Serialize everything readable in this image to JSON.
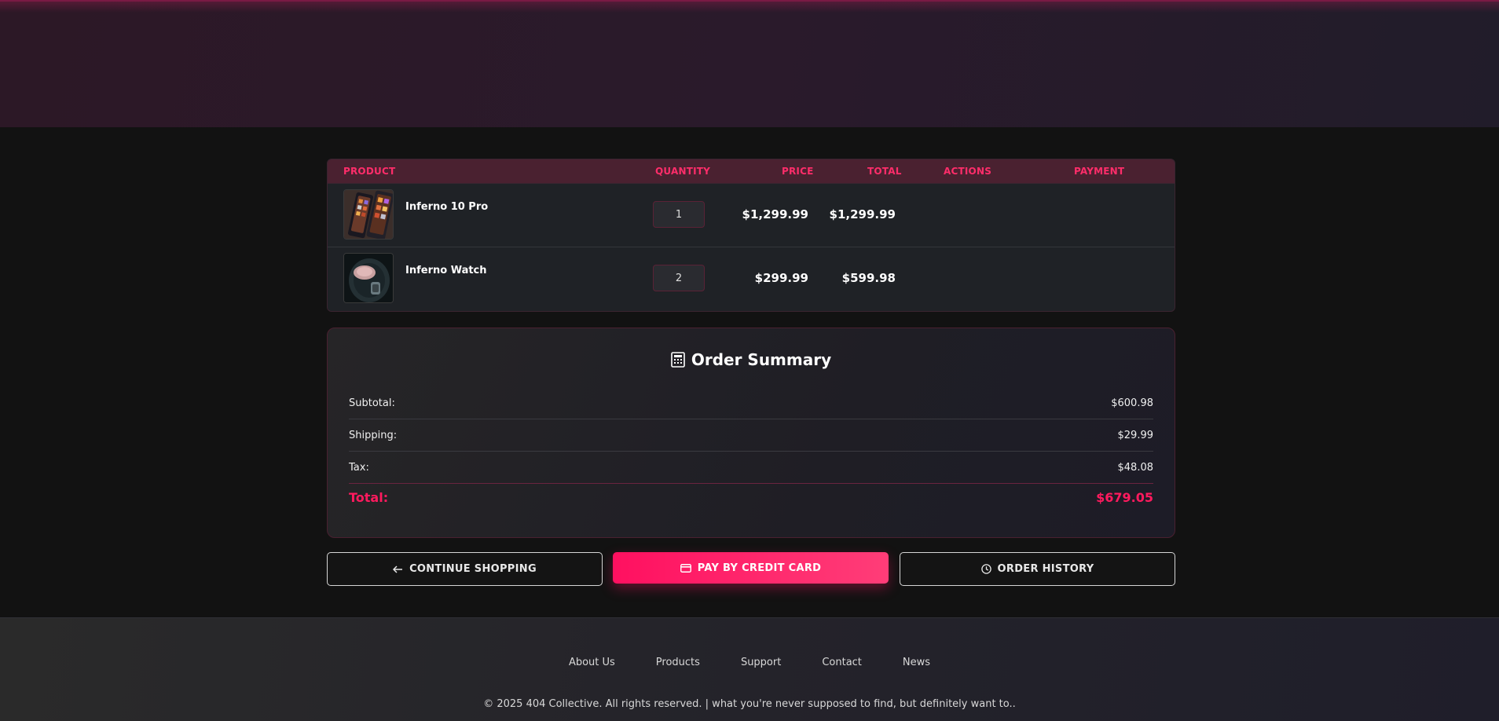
{
  "table": {
    "headers": {
      "product": "PRODUCT",
      "quantity": "QUANTITY",
      "price": "PRICE",
      "total": "TOTAL",
      "actions": "ACTIONS",
      "payment": "PAYMENT"
    },
    "rows": [
      {
        "name": "Inferno 10 Pro",
        "quantity": "1",
        "price": "$1,299.99",
        "total": "$1,299.99",
        "image": "phone-image"
      },
      {
        "name": "Inferno Watch",
        "quantity": "2",
        "price": "$299.99",
        "total": "$599.98",
        "image": "watch-image"
      }
    ]
  },
  "summary": {
    "icon": "receipt-icon",
    "title": "Order Summary",
    "subtotal_label": "Subtotal:",
    "subtotal_value": "$600.98",
    "shipping_label": "Shipping:",
    "shipping_value": "$29.99",
    "tax_label": "Tax:",
    "tax_value": "$48.08",
    "total_label": "Total:",
    "total_value": "$679.05"
  },
  "buttons": {
    "continue_label": "CONTINUE SHOPPING",
    "continue_icon": "arrow-left-icon",
    "pay_label": "PAY BY CREDIT CARD",
    "pay_icon": "credit-card-icon",
    "history_label": "ORDER HISTORY",
    "history_icon": "clock-icon"
  },
  "footer": {
    "links": [
      "About Us",
      "Products",
      "Support",
      "Contact",
      "News"
    ],
    "copyright": "© 2025 404 Collective. All rights reserved. | what you're never supposed to find, but definitely want to.."
  },
  "colors": {
    "accent": "#ff1a5e",
    "background": "#121212",
    "header_row": "#4a2130"
  }
}
